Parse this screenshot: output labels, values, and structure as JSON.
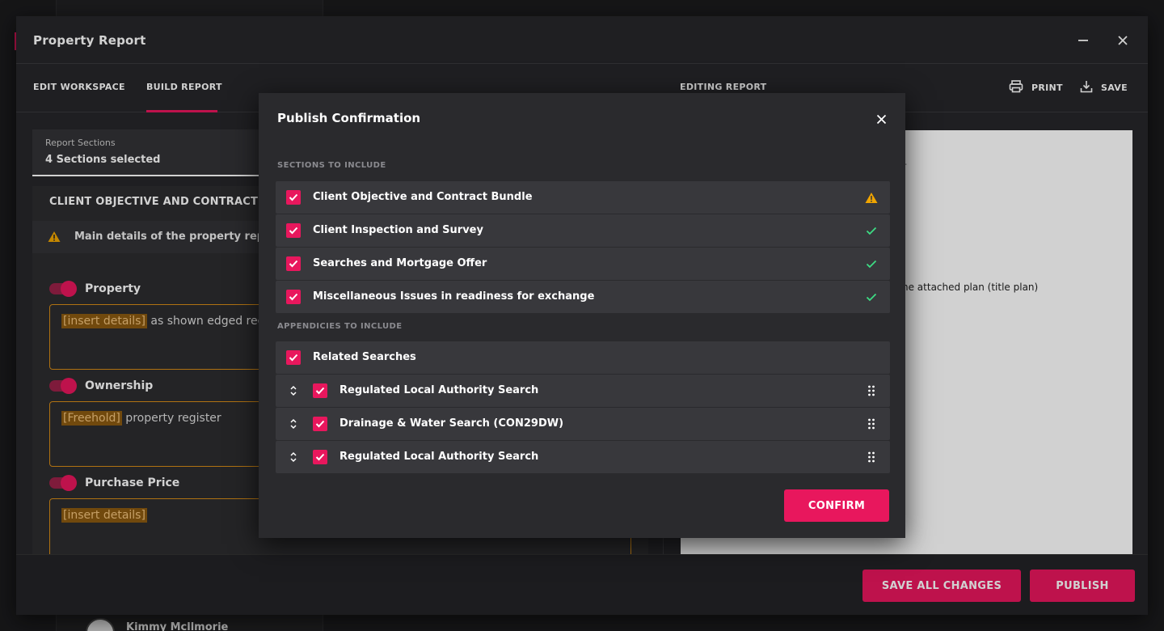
{
  "window": {
    "title": "Property Report",
    "minimize_icon": "minimize-icon",
    "close_icon": "close-icon"
  },
  "tabs": [
    {
      "label": "EDIT WORKSPACE",
      "active": false
    },
    {
      "label": "BUILD REPORT",
      "active": true
    }
  ],
  "editing_label": "EDITING REPORT",
  "toolbar": {
    "print_label": "PRINT",
    "save_label": "SAVE"
  },
  "sections_select": {
    "label": "Report Sections",
    "value": "4 Sections selected"
  },
  "left_panel": {
    "section_title": "CLIENT OBJECTIVE AND CONTRACT BUNDLE",
    "warning_text": "Main details of the property report",
    "fields": [
      {
        "label": "Property",
        "enabled": true,
        "highlight": "[insert details]",
        "text": " as shown edged red"
      },
      {
        "label": "Ownership",
        "enabled": true,
        "highlight": "[Freehold]",
        "text": " property register"
      },
      {
        "label": "Purchase Price",
        "enabled": true,
        "highlight": "[insert details]",
        "text": ""
      }
    ]
  },
  "preview": {
    "mark": "-",
    "text": "he attached plan (title plan)"
  },
  "footer": {
    "save_all_label": "SAVE ALL CHANGES",
    "publish_label": "PUBLISH"
  },
  "background": {
    "user_name": "Kimmy Mcllmorie"
  },
  "modal": {
    "title": "Publish Confirmation",
    "sections_heading": "SECTIONS TO INCLUDE",
    "sections": [
      {
        "label": "Client Objective and Contract Bundle",
        "checked": true,
        "status": "warning"
      },
      {
        "label": "Client Inspection and Survey",
        "checked": true,
        "status": "complete"
      },
      {
        "label": "Searches and Mortgage Offer",
        "checked": true,
        "status": "complete"
      },
      {
        "label": "Miscellaneous Issues in readiness for exchange",
        "checked": true,
        "status": "complete"
      }
    ],
    "appendices_heading": "APPENDICIES TO INCLUDE",
    "appendix_group": {
      "label": "Related Searches",
      "checked": true
    },
    "appendices": [
      {
        "label": "Regulated Local Authority Search",
        "checked": true
      },
      {
        "label": "Drainage & Water Search (CON29DW)",
        "checked": true
      },
      {
        "label": "Regulated Local Authority Search",
        "checked": true
      }
    ],
    "confirm_label": "CONFIRM"
  },
  "colors": {
    "accent": "#e8175d",
    "warning": "#f0a500",
    "success": "#3ddc84",
    "highlight_border": "#d78b16"
  }
}
